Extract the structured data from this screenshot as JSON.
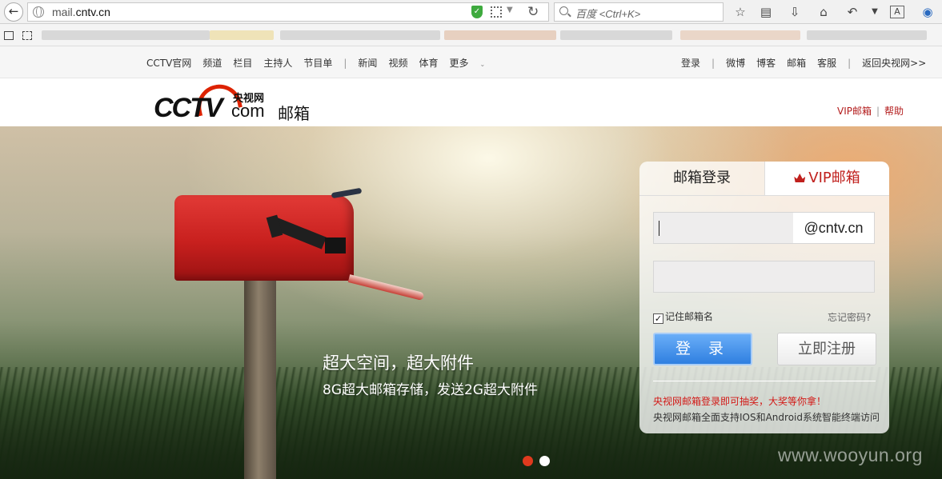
{
  "browser": {
    "url_prefix": "mail.",
    "url_domain": "cntv.cn",
    "search_placeholder": "百度 <Ctrl+K>"
  },
  "site_nav": {
    "left_items": [
      "CCTV官网",
      "频道",
      "栏目",
      "主持人",
      "节目单",
      "|",
      "新闻",
      "视频",
      "体育",
      "更多"
    ],
    "right_items": [
      "登录",
      "|",
      "微博",
      "博客",
      "邮箱",
      "客服",
      "|",
      "返回央视网>>"
    ]
  },
  "header": {
    "logo_cctv": "CCTV",
    "logo_yangshi": "央视网",
    "logo_com": "com",
    "logo_mail": "邮箱",
    "vip_link": "VIP邮箱",
    "help_link": "帮助"
  },
  "hero": {
    "title": "超大空间，超大附件",
    "subtitle": "8G超大邮箱存储，发送2G超大附件",
    "watermark": "www.wooyun.org",
    "slides_total": 2,
    "active_slide": 1
  },
  "login": {
    "tab_login": "邮箱登录",
    "tab_vip": "VIP邮箱",
    "username_value": "",
    "domain_suffix": "@cntv.cn",
    "password_value": "",
    "remember_label": "记住邮箱名",
    "remember_checked": true,
    "forgot_label": "忘记密码?",
    "login_button": "登 录",
    "register_button": "立即注册",
    "promo_text": "央视网邮箱登录即可抽奖，大奖等你拿！",
    "support_text": "央视网邮箱全面支持IOS和Android系统智能终端访问"
  },
  "colors": {
    "accent_red": "#c0201d",
    "login_blue": "#2f7fe0",
    "active_dot": "#e03a1e"
  }
}
